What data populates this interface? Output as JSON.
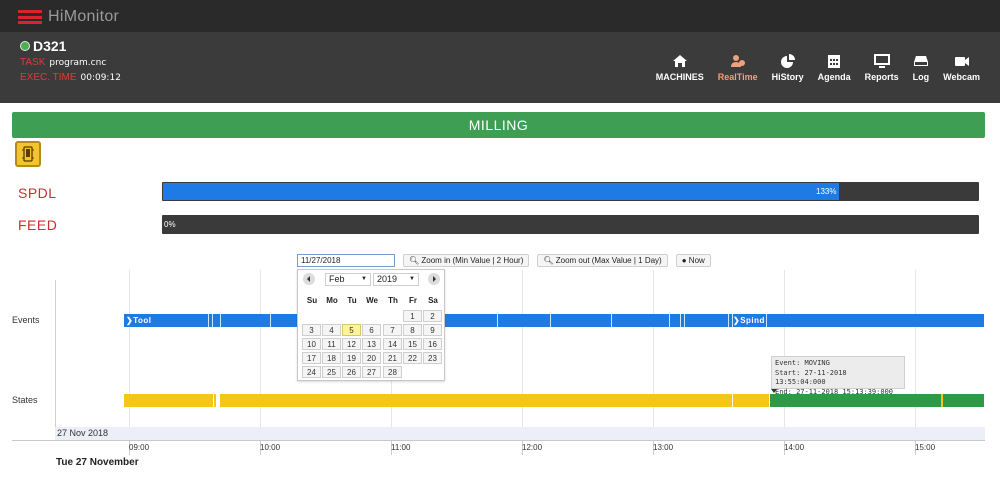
{
  "app": {
    "title": "HiMonitor"
  },
  "machine": {
    "name": "D321",
    "status_color": "#4caf50",
    "task_label": "TASK",
    "task_value": "program.cnc",
    "exec_label": "EXEC. TIME",
    "exec_value": "00:09:12"
  },
  "nav": [
    {
      "label": "MACHINES",
      "icon": "home-icon"
    },
    {
      "label": "RealTime",
      "icon": "users-icon",
      "active": true
    },
    {
      "label": "HiStory",
      "icon": "pie-chart-icon"
    },
    {
      "label": "Agenda",
      "icon": "calendar-icon"
    },
    {
      "label": "Reports",
      "icon": "monitor-icon"
    },
    {
      "label": "Log",
      "icon": "drive-icon"
    },
    {
      "label": "Webcam",
      "icon": "video-camera-icon"
    }
  ],
  "status_banner": {
    "text": "MILLING",
    "color": "#3e9e53"
  },
  "bars": {
    "spdl": {
      "label": "SPDL",
      "value_text": "133%",
      "fill_fraction": 0.83
    },
    "feed": {
      "label": "FEED",
      "value_text": "0%",
      "fill_fraction": 0.0
    }
  },
  "controls": {
    "date_value": "11/27/2018",
    "zoom_in": "Zoom in (Min Value | 2 Hour)",
    "zoom_out": "Zoom out (Max Value | 1 Day)",
    "now": "Now"
  },
  "calendar": {
    "month": "Feb",
    "year": "2019",
    "weekdays": [
      "Su",
      "Mo",
      "Tu",
      "We",
      "Th",
      "Fr",
      "Sa"
    ],
    "weeks": [
      [
        "",
        "",
        "",
        "",
        "",
        "1",
        "2"
      ],
      [
        "3",
        "4",
        "5",
        "6",
        "7",
        "8",
        "9"
      ],
      [
        "10",
        "11",
        "12",
        "13",
        "14",
        "15",
        "16"
      ],
      [
        "17",
        "18",
        "19",
        "20",
        "21",
        "22",
        "23"
      ],
      [
        "24",
        "25",
        "26",
        "27",
        "28",
        "",
        ""
      ]
    ],
    "today": "5"
  },
  "timeline": {
    "groups": {
      "events": "Events",
      "states": "States"
    },
    "event_labels": {
      "tool": "Tool",
      "spindle": "Spind"
    },
    "tooltip": {
      "line1": "Event: MOVING",
      "line2": "Start: 27-11-2018 13:55:04:000",
      "line3": "End: 27-11-2018 15:13:39:000"
    },
    "date_strip": "27 Nov 2018",
    "hours": [
      "09:00",
      "10:00",
      "11:00",
      "12:00",
      "13:00",
      "14:00",
      "15:00"
    ],
    "major_label": "Tue 27 November",
    "colors": {
      "event": "#1e7be6",
      "state_idle": "#f5c518",
      "state_moving": "#2e9a45"
    }
  }
}
